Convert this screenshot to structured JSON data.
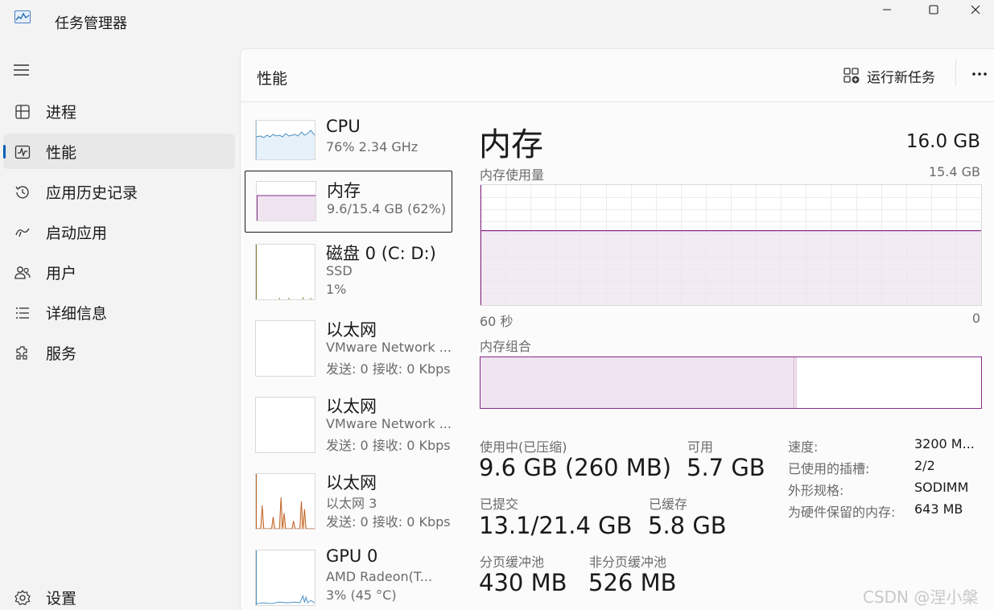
{
  "window": {
    "title": "任务管理器"
  },
  "nav": {
    "items": [
      {
        "key": "processes",
        "label": "进程",
        "icon": "processes-icon"
      },
      {
        "key": "performance",
        "label": "性能",
        "icon": "performance-icon",
        "active": true
      },
      {
        "key": "app-history",
        "label": "应用历史记录",
        "icon": "history-icon"
      },
      {
        "key": "startup",
        "label": "启动应用",
        "icon": "startup-icon"
      },
      {
        "key": "users",
        "label": "用户",
        "icon": "users-icon"
      },
      {
        "key": "details",
        "label": "详细信息",
        "icon": "details-icon"
      },
      {
        "key": "services",
        "label": "服务",
        "icon": "services-icon"
      }
    ],
    "settings_label": "设置"
  },
  "header": {
    "title": "性能",
    "run_new_task": "运行新任务"
  },
  "devices": [
    {
      "key": "cpu",
      "name": "CPU",
      "sub1": "76% 2.34 GHz",
      "sub2": ""
    },
    {
      "key": "memory",
      "name": "内存",
      "sub1": "9.6/15.4 GB (62%)",
      "sub2": "",
      "selected": true
    },
    {
      "key": "disk",
      "name": "磁盘 0 (C: D:)",
      "sub1": "SSD",
      "sub2": "1%"
    },
    {
      "key": "eth1",
      "name": "以太网",
      "sub1": "VMware Network ...",
      "sub2": "发送: 0 接收: 0 Kbps"
    },
    {
      "key": "eth2",
      "name": "以太网",
      "sub1": "VMware Network ...",
      "sub2": "发送: 0 接收: 0 Kbps"
    },
    {
      "key": "eth3",
      "name": "以太网",
      "sub1": "以太网 3",
      "sub2": "发送: 0 接收: 0 Kbps"
    },
    {
      "key": "gpu",
      "name": "GPU 0",
      "sub1": "AMD Radeon(T...",
      "sub2": "3% (45 °C)"
    }
  ],
  "detail": {
    "title": "内存",
    "total": "16.0 GB",
    "usage_label": "内存使用量",
    "usage_max": "15.4 GB",
    "usage_fraction": 0.62,
    "axis_left": "60 秒",
    "axis_right": "0",
    "composition_label": "内存组合",
    "stats": {
      "in_use_label": "使用中(已压缩)",
      "in_use_value": "9.6 GB (260 MB)",
      "available_label": "可用",
      "available_value": "5.7 GB",
      "committed_label": "已提交",
      "committed_value": "13.1/21.4 GB",
      "cached_label": "已缓存",
      "cached_value": "5.8 GB",
      "paged_label": "分页缓冲池",
      "paged_value": "430 MB",
      "nonpaged_label": "非分页缓冲池",
      "nonpaged_value": "526 MB"
    },
    "specs": [
      {
        "key": "速度:",
        "value": "3200 M..."
      },
      {
        "key": "已使用的插槽:",
        "value": "2/2"
      },
      {
        "key": "外形规格:",
        "value": "SODIMM"
      },
      {
        "key": "为硬件保留的内存:",
        "value": "643 MB"
      }
    ]
  },
  "colors": {
    "accent": "#005fb8",
    "memory": "#8b2a8b",
    "memory_fill": "#efe4f0",
    "cpu": "#4a90c2",
    "disk": "#8a7a2a",
    "ethernet": "#c06020"
  },
  "watermark": "CSDN @涅小槃"
}
